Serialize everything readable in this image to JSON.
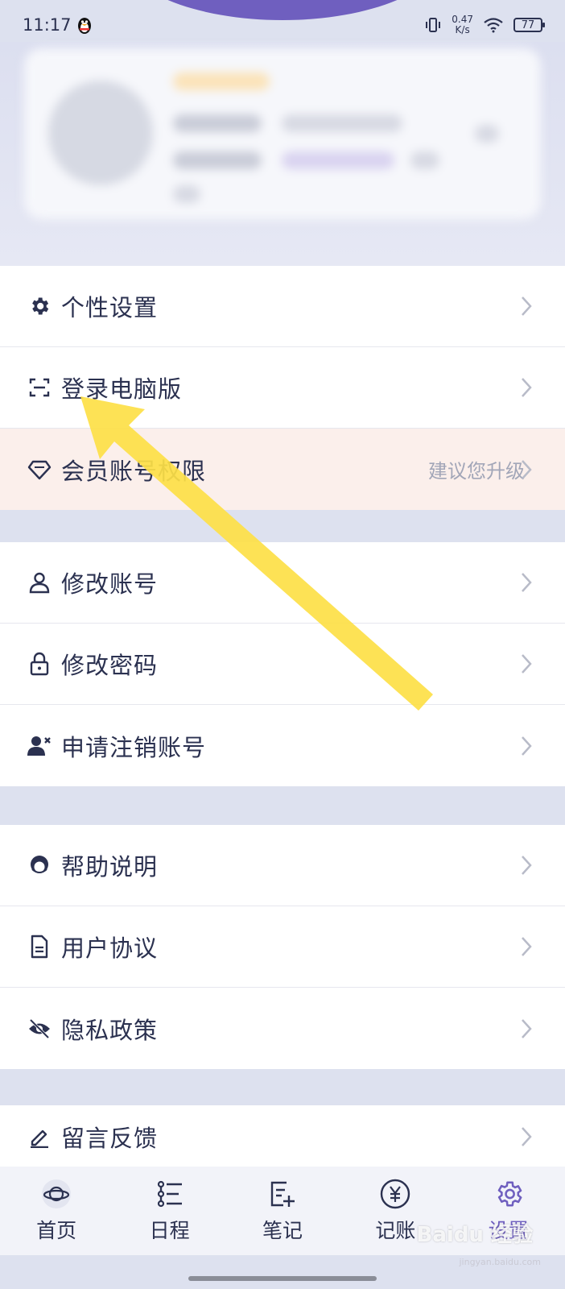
{
  "status_bar": {
    "time": "11:17",
    "net_speed_value": "0.47",
    "net_speed_unit": "K/s",
    "battery": "77"
  },
  "menu": {
    "group1": [
      {
        "label": "个性设置",
        "icon": "gear-icon"
      },
      {
        "label": "登录电脑版",
        "icon": "scan-icon"
      },
      {
        "label": "会员账号权限",
        "icon": "diamond-icon",
        "hint": "建议您升级"
      }
    ],
    "group2": [
      {
        "label": "修改账号",
        "icon": "user-icon"
      },
      {
        "label": "修改密码",
        "icon": "lock-icon"
      },
      {
        "label": "申请注销账号",
        "icon": "user-remove-icon"
      }
    ],
    "group3": [
      {
        "label": "帮助说明",
        "icon": "support-icon"
      },
      {
        "label": "用户协议",
        "icon": "document-icon"
      },
      {
        "label": "隐私政策",
        "icon": "eye-off-icon"
      }
    ],
    "group4": [
      {
        "label": "留言反馈",
        "icon": "edit-icon"
      }
    ]
  },
  "tabs": [
    {
      "label": "首页",
      "icon": "planet-icon"
    },
    {
      "label": "日程",
      "icon": "schedule-icon"
    },
    {
      "label": "笔记",
      "icon": "note-icon"
    },
    {
      "label": "记账",
      "icon": "yen-icon"
    },
    {
      "label": "设置",
      "icon": "gear-icon",
      "active": true
    }
  ],
  "colors": {
    "accent": "#6f5fbf",
    "highlight_arrow": "#fde046",
    "text": "#2b3150",
    "hint": "#a2a6b8"
  },
  "watermark": {
    "brand": "Baidu 经验",
    "url": "jingyan.baidu.com"
  }
}
